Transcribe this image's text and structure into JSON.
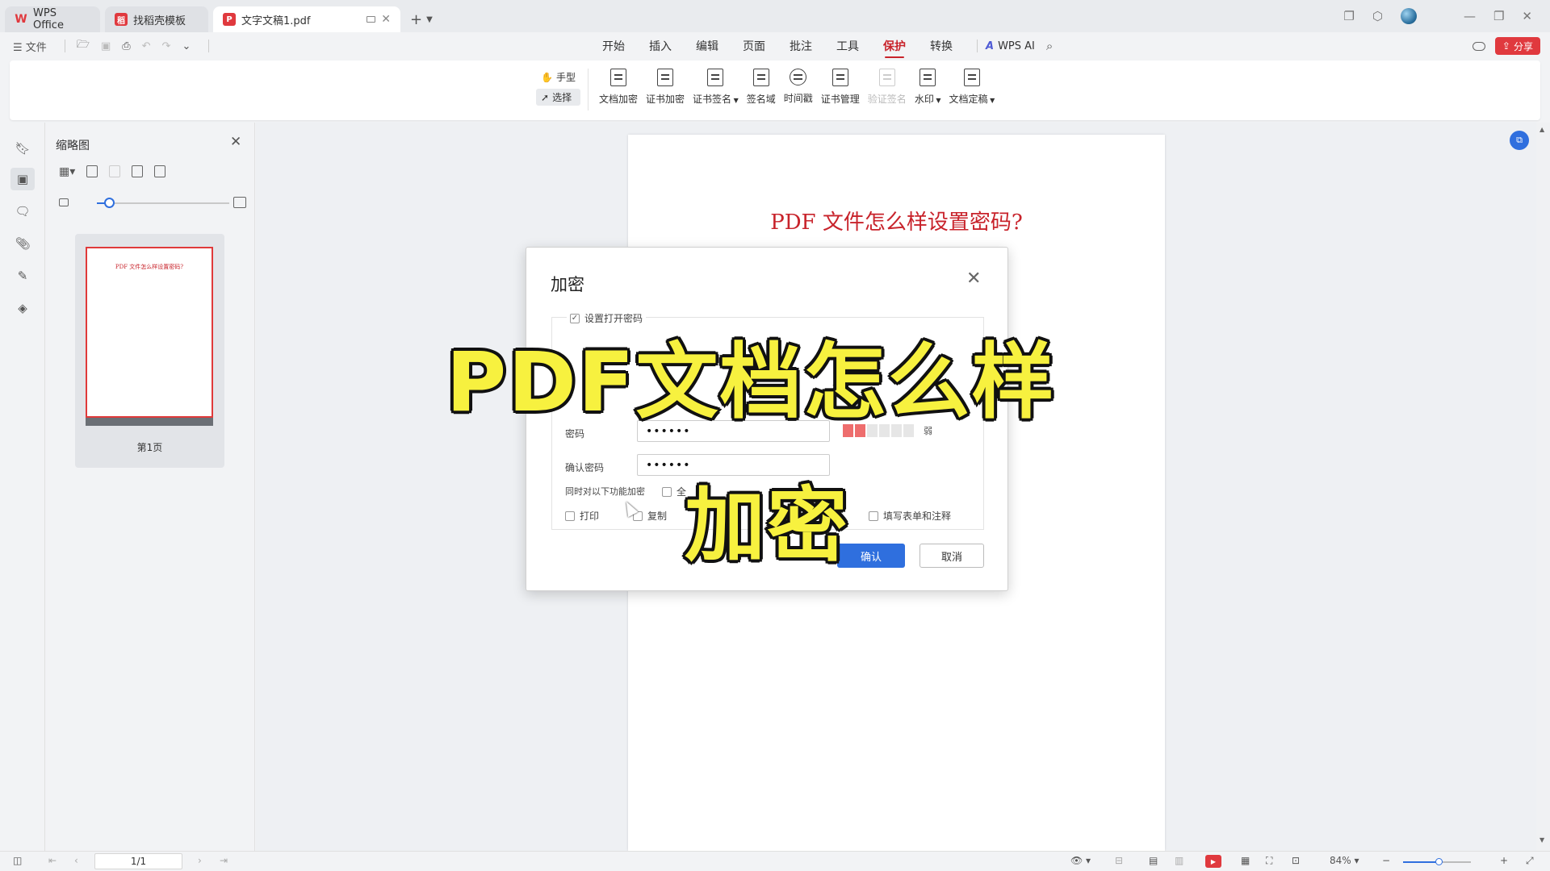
{
  "tabs": [
    {
      "label": "WPS Office",
      "icon": "wps-logo-icon",
      "color": "#e0393e"
    },
    {
      "label": "找稻壳模板",
      "icon": "daoke-icon",
      "color": "#e0393e"
    },
    {
      "label": "文字文稿1.pdf",
      "icon": "pdf-icon",
      "color": "#e0393e"
    }
  ],
  "menu": {
    "file_label": "文件",
    "tabs": [
      "开始",
      "插入",
      "编辑",
      "页面",
      "批注",
      "工具",
      "保护",
      "转换"
    ],
    "active_tab": "保护",
    "wps_ai": "WPS AI",
    "share": "分享"
  },
  "ribbon": {
    "hand": "手型",
    "select": "选择",
    "tools": [
      {
        "label": "文档加密",
        "enabled": true,
        "dropdown": false
      },
      {
        "label": "证书加密",
        "enabled": true,
        "dropdown": false
      },
      {
        "label": "证书签名",
        "enabled": true,
        "dropdown": true
      },
      {
        "label": "签名域",
        "enabled": true,
        "dropdown": false
      },
      {
        "label": "时间戳",
        "enabled": true,
        "dropdown": false
      },
      {
        "label": "证书管理",
        "enabled": true,
        "dropdown": false
      },
      {
        "label": "验证签名",
        "enabled": false,
        "dropdown": false
      },
      {
        "label": "水印",
        "enabled": true,
        "dropdown": true
      },
      {
        "label": "文档定稿",
        "enabled": true,
        "dropdown": true
      }
    ]
  },
  "thumbnail_panel": {
    "title": "缩略图",
    "zoom_level": 0.1,
    "page_text": "PDF 文件怎么样设置密码?",
    "page_label": "第1页"
  },
  "document": {
    "title": "PDF 文件怎么样设置密码?"
  },
  "dialog": {
    "title": "加密",
    "set_open_password": "设置打开密码",
    "open_password_checked": true,
    "password_label": "密码",
    "password_value": "••••••",
    "confirm_label": "确认密码",
    "confirm_value": "••••••",
    "strength_label": "弱",
    "also_encrypt_label": "同时对以下功能加密",
    "select_all_label": "全",
    "options": [
      "打印",
      "复制",
      "填写表单和注释"
    ],
    "ok": "确认",
    "cancel": "取消"
  },
  "overlay": {
    "line1": "PDF文档怎么样",
    "line2": "加密"
  },
  "statusbar": {
    "page": "1/1",
    "zoom": "84%"
  },
  "colors": {
    "accent_red": "#c8232b",
    "primary_blue": "#2f6fde",
    "caption_yellow": "#f7f13f"
  }
}
